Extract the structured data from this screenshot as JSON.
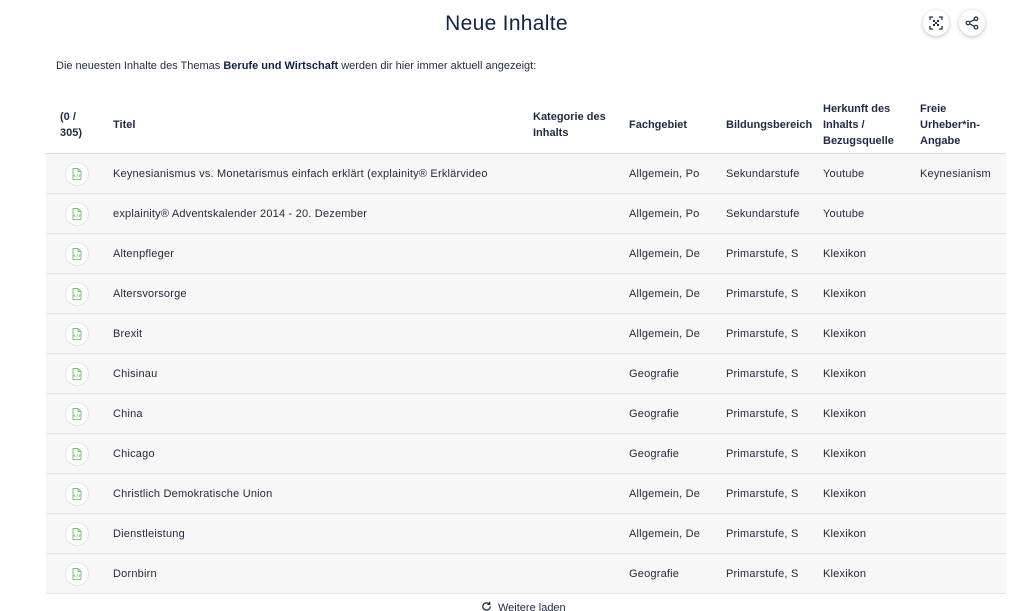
{
  "header": {
    "title": "Neue Inhalte",
    "qr_icon": "qr-code-icon",
    "share_icon": "share-icon"
  },
  "intro": {
    "prefix": "Die neuesten Inhalte des Themas ",
    "topic": "Berufe und Wirtschaft",
    "suffix": " werden dir hier immer aktuell angezeigt:"
  },
  "table": {
    "headers": {
      "count": "(0 / 305)",
      "title": "Titel",
      "category": "Kategorie des Inhalts",
      "subject": "Fachgebiet",
      "education": "Bildungsbereich",
      "source": "Herkunft des Inhalts / Bezugsquelle",
      "author": "Freie Urheber*in-Angabe"
    },
    "rows": [
      {
        "icon": "document-icon",
        "title": "Keynesianismus vs. Monetarismus einfach erklärt (explainity® Erklärvideo",
        "category": "",
        "subject": "Allgemein, Po",
        "education": "Sekundarstufe",
        "source": "Youtube",
        "author": "Keynesianism"
      },
      {
        "icon": "document-icon",
        "title": "explainity® Adventskalender 2014 - 20. Dezember",
        "category": "",
        "subject": "Allgemein, Po",
        "education": "Sekundarstufe",
        "source": "Youtube",
        "author": ""
      },
      {
        "icon": "document-icon",
        "title": "Altenpfleger",
        "category": "",
        "subject": "Allgemein, De",
        "education": "Primarstufe, S",
        "source": "Klexikon",
        "author": ""
      },
      {
        "icon": "document-icon",
        "title": "Altersvorsorge",
        "category": "",
        "subject": "Allgemein, De",
        "education": "Primarstufe, S",
        "source": "Klexikon",
        "author": ""
      },
      {
        "icon": "document-icon",
        "title": "Brexit",
        "category": "",
        "subject": "Allgemein, De",
        "education": "Primarstufe, S",
        "source": "Klexikon",
        "author": ""
      },
      {
        "icon": "document-icon",
        "title": "Chisinau",
        "category": "",
        "subject": "Geografie",
        "education": "Primarstufe, S",
        "source": "Klexikon",
        "author": ""
      },
      {
        "icon": "document-icon",
        "title": "China",
        "category": "",
        "subject": "Geografie",
        "education": "Primarstufe, S",
        "source": "Klexikon",
        "author": ""
      },
      {
        "icon": "document-icon",
        "title": "Chicago",
        "category": "",
        "subject": "Geografie",
        "education": "Primarstufe, S",
        "source": "Klexikon",
        "author": ""
      },
      {
        "icon": "document-icon",
        "title": "Christlich Demokratische Union",
        "category": "",
        "subject": "Allgemein, De",
        "education": "Primarstufe, S",
        "source": "Klexikon",
        "author": ""
      },
      {
        "icon": "document-icon",
        "title": "Dienstleistung",
        "category": "",
        "subject": "Allgemein, De",
        "education": "Primarstufe, S",
        "source": "Klexikon",
        "author": ""
      },
      {
        "icon": "document-icon",
        "title": "Dornbirn",
        "category": "",
        "subject": "Geografie",
        "education": "Primarstufe, S",
        "source": "Klexikon",
        "author": ""
      }
    ]
  },
  "footer": {
    "load_more_label": "Weitere laden",
    "load_more_icon": "refresh-icon"
  },
  "colors": {
    "title": "#0f2248",
    "row_background": "#f7f7f8",
    "icon_green": "#6bbf6a"
  }
}
